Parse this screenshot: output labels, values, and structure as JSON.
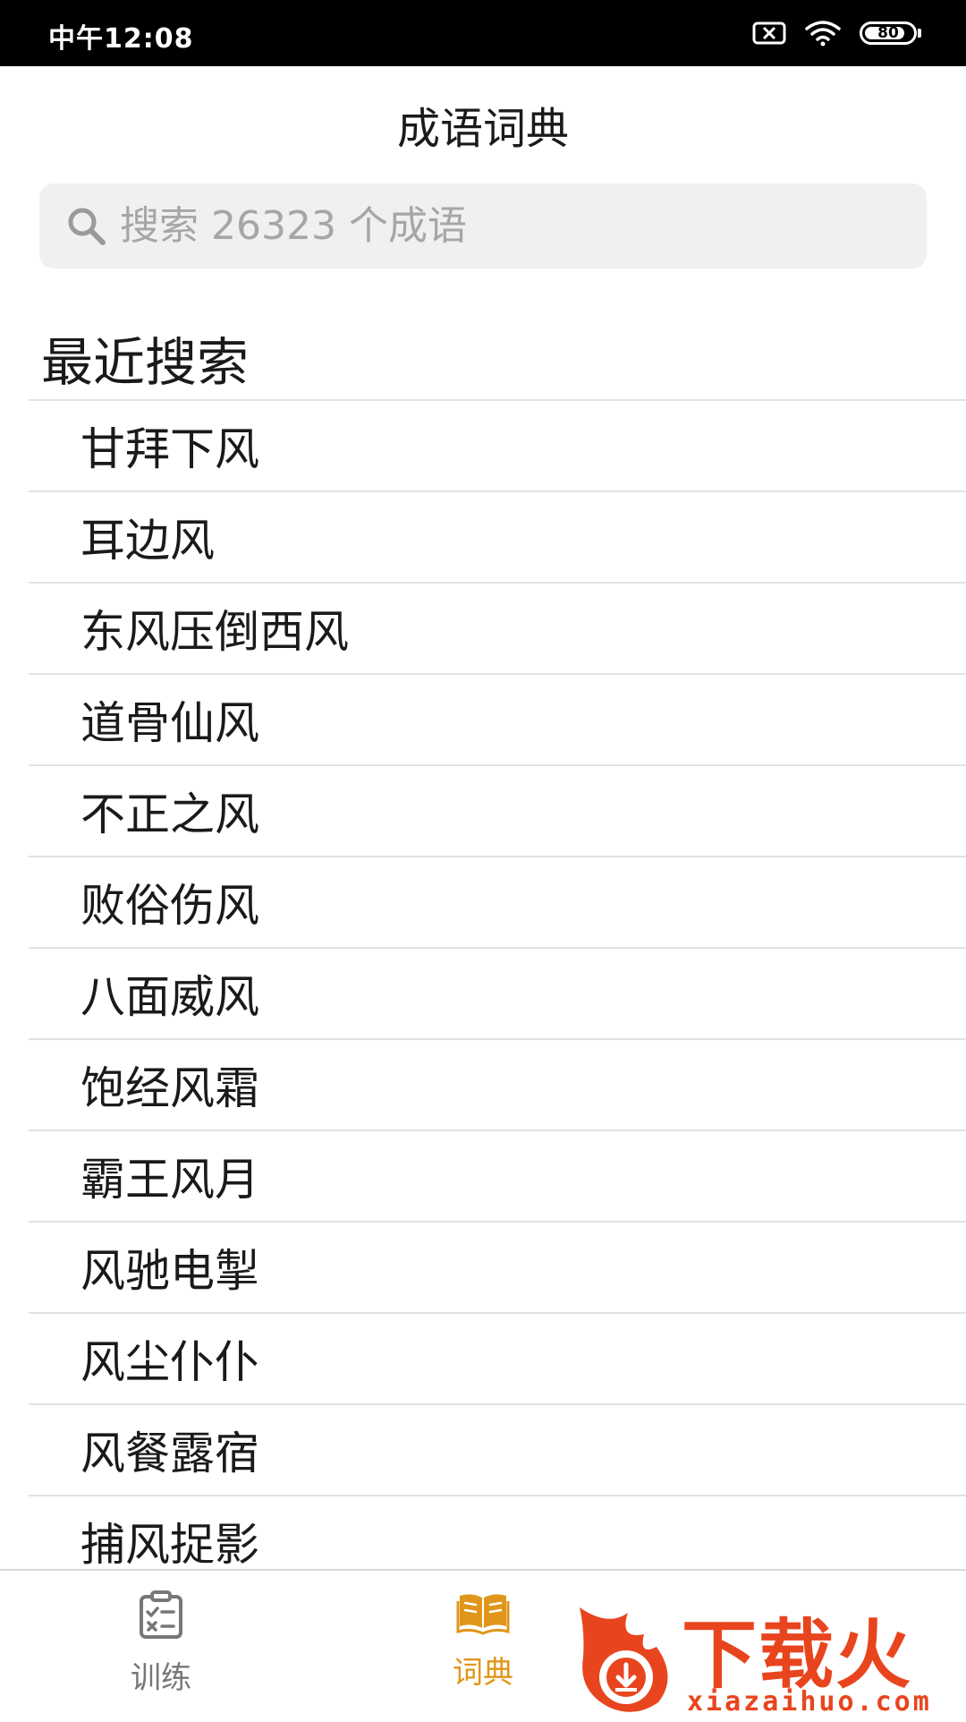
{
  "status_bar": {
    "time": "中午12:08",
    "battery": "80",
    "icons": [
      "sim-card-blocked-icon",
      "wifi-icon",
      "battery-icon"
    ]
  },
  "header": {
    "title": "成语词典"
  },
  "search": {
    "placeholder": "搜索 26323 个成语"
  },
  "recent": {
    "title": "最近搜索",
    "items": [
      "甘拜下风",
      "耳边风",
      "东风压倒西风",
      "道骨仙风",
      "不正之风",
      "败俗伤风",
      "八面威风",
      "饱经风霜",
      "霸王风月",
      "风驰电掣",
      "风尘仆仆",
      "风餐露宿",
      "捕风捉影"
    ]
  },
  "tab_bar": {
    "tabs": [
      {
        "label": "训练",
        "icon": "clipboard-checklist-icon",
        "active": false
      },
      {
        "label": "词典",
        "icon": "open-book-icon",
        "active": true
      }
    ]
  },
  "watermark": {
    "text": "下载火",
    "url": "xiazaihuo.com"
  },
  "colors": {
    "accent": "#e0961a",
    "inactive": "#777777",
    "search_bg": "#f0f0f2",
    "divider": "#e2e2e2",
    "watermark": "#e8451e"
  }
}
